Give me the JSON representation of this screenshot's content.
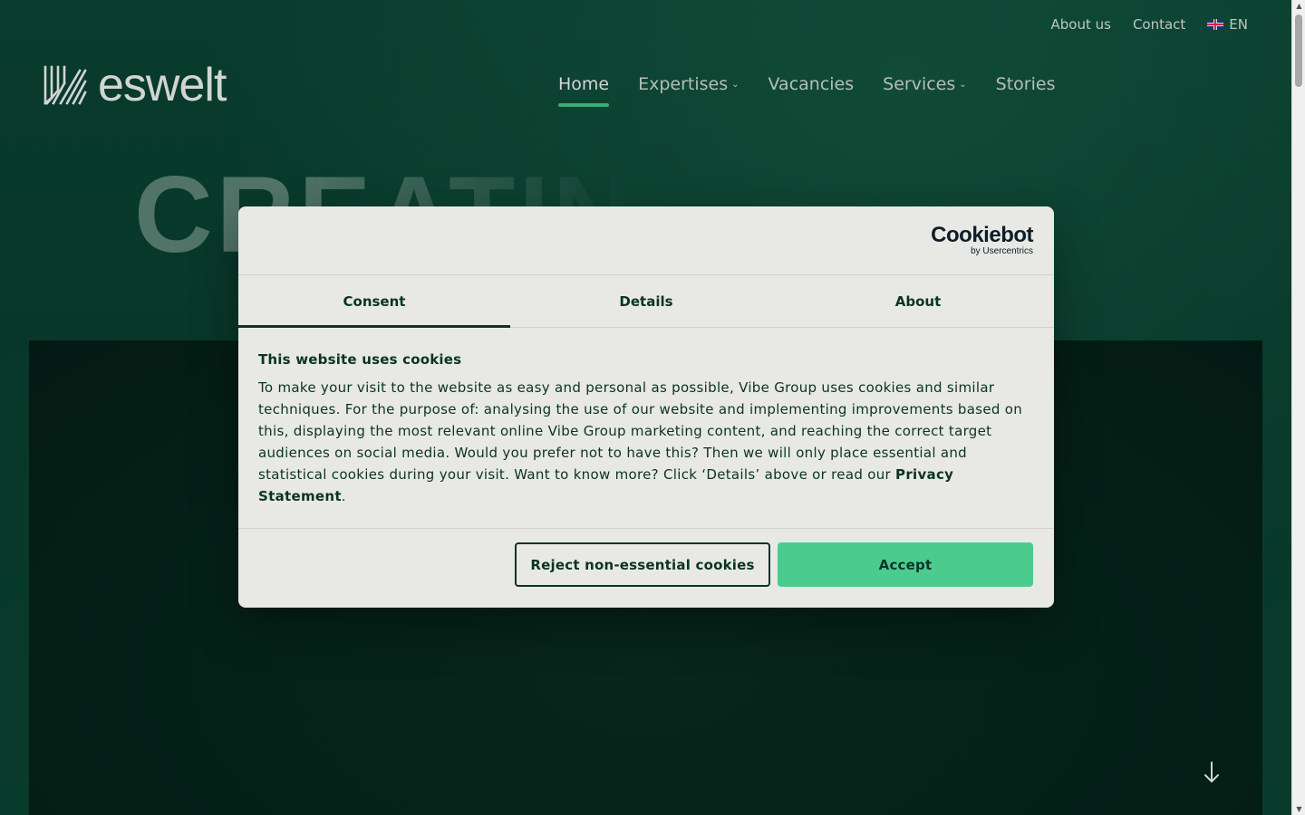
{
  "util_nav": {
    "about": "About us",
    "contact": "Contact",
    "language": "EN"
  },
  "logo": {
    "text": "eswelt"
  },
  "main_nav": {
    "items": [
      {
        "label": "Home",
        "active": true,
        "dropdown": false
      },
      {
        "label": "Expertises",
        "active": false,
        "dropdown": true
      },
      {
        "label": "Vacancies",
        "active": false,
        "dropdown": false
      },
      {
        "label": "Services",
        "active": false,
        "dropdown": true
      },
      {
        "label": "Stories",
        "active": false,
        "dropdown": false
      }
    ]
  },
  "hero": {
    "word": "CREATIN"
  },
  "cookie_dialog": {
    "brand": "Cookiebot",
    "brand_sub": "by Usercentrics",
    "tabs": [
      "Consent",
      "Details",
      "About"
    ],
    "title": "This website uses cookies",
    "body": "To make your visit to the website as easy and personal as possible, Vibe Group uses cookies and similar techniques. For the purpose of: analysing the use of our website and implementing improvements based on this, displaying the most relevant online Vibe Group marketing content, and reaching the correct target audiences on social media. Would you prefer not to have this? Then we will only place essential and statistical cookies during your visit. Want to know more? Click ‘Details’ above or read our ",
    "privacy_link": "Privacy Statement",
    "body_end": ".",
    "reject_label": "Reject non-essential cookies",
    "accept_label": "Accept"
  },
  "colors": {
    "bg": "#0a3f30",
    "accent": "#4ccb8f",
    "dialog_bg": "#e8e9e4",
    "dialog_text": "#0b3328"
  },
  "icons": {
    "flag": "uk-flag-icon",
    "chevron": "chevron-down-icon",
    "scroll": "arrow-down-icon"
  }
}
